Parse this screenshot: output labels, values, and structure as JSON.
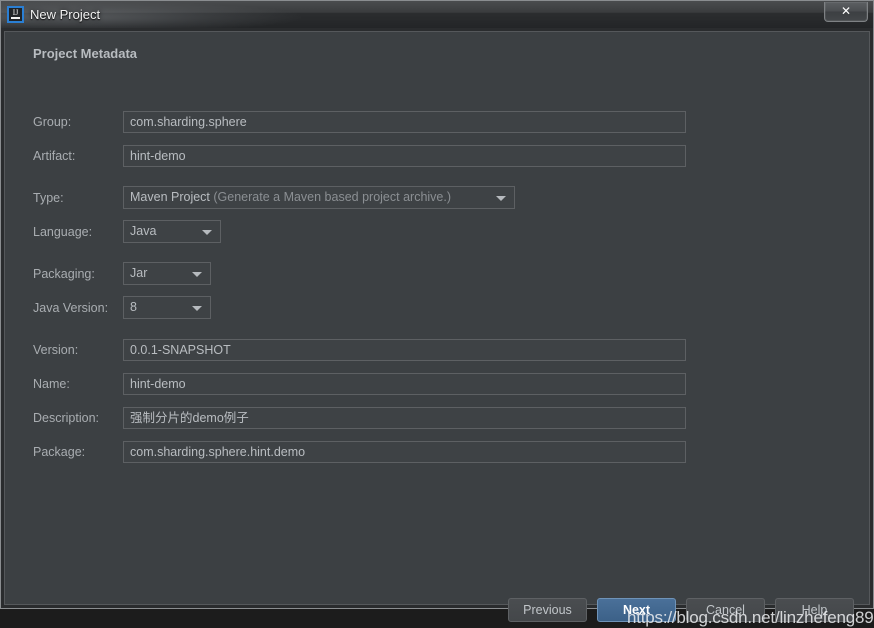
{
  "window": {
    "title": "New Project",
    "app_icon": "intellij-idea-icon",
    "icon_letters": "IJ",
    "close_label": "✕"
  },
  "form": {
    "section_title": "Project Metadata",
    "fields": [
      {
        "label": "Group:",
        "value": "com.sharding.sphere",
        "type": "text"
      },
      {
        "label": "Artifact:",
        "value": "hint-demo",
        "type": "text"
      },
      {
        "label": "Type:",
        "value": "Maven Project",
        "hint": "(Generate a Maven based project archive.)",
        "type": "combo"
      },
      {
        "label": "Language:",
        "value": "Java",
        "type": "combo"
      },
      {
        "label": "Packaging:",
        "value": "Jar",
        "type": "combo"
      },
      {
        "label": "Java Version:",
        "value": "8",
        "type": "combo"
      },
      {
        "label": "Version:",
        "value": "0.0.1-SNAPSHOT",
        "type": "text"
      },
      {
        "label": "Name:",
        "value": "hint-demo",
        "type": "text"
      },
      {
        "label": "Description:",
        "value": "强制分片的demo例子",
        "type": "text"
      },
      {
        "label": "Package:",
        "value": "com.sharding.sphere.hint.demo",
        "type": "text"
      }
    ]
  },
  "buttons": {
    "previous": "Previous",
    "next": "Next",
    "cancel": "Cancel",
    "help": "Help"
  },
  "watermark": "https://blog.csdn.net/linzhefeng89",
  "colors": {
    "dialog_background": "#3c4043",
    "field_background": "#3e4245",
    "field_border": "#5d6063",
    "label_text": "#a9adb1",
    "value_text": "#b9bdc1",
    "primary_button": "#3c6188",
    "accent_icon_border": "#2a7fd4"
  }
}
